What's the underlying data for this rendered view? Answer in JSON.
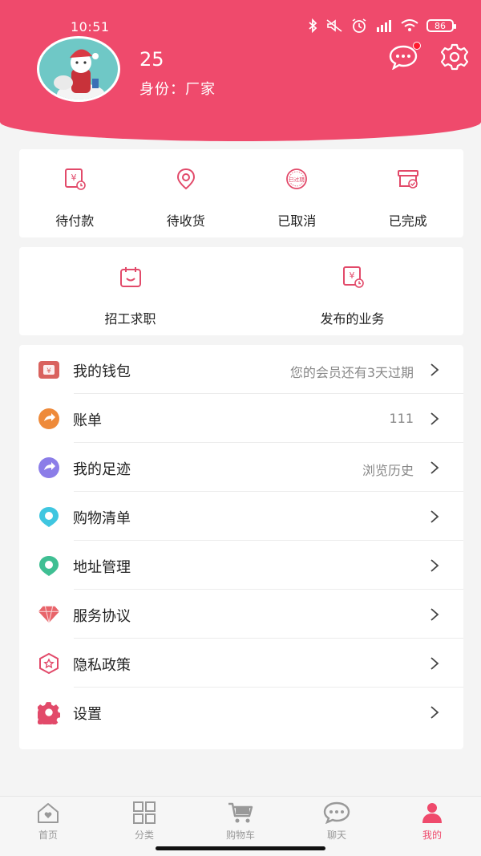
{
  "status_bar": {
    "time": "10:51",
    "battery": "86"
  },
  "profile": {
    "name": "25",
    "role": "身份：厂家"
  },
  "colors": {
    "accent": "#ef4a6c",
    "notification_dot": "#ff1a2e"
  },
  "orders": [
    {
      "label": "待付款",
      "icon": "payment-icon"
    },
    {
      "label": "待收货",
      "icon": "location-pin-icon"
    },
    {
      "label": "已取消",
      "icon": "cancelled-stamp-icon",
      "icon_text": "已过期"
    },
    {
      "label": "已完成",
      "icon": "completed-box-icon"
    }
  ],
  "business": [
    {
      "label": "招工求职",
      "icon": "calendar-smile-icon"
    },
    {
      "label": "发布的业务",
      "icon": "yuan-document-icon"
    }
  ],
  "menu": [
    {
      "label": "我的钱包",
      "value": "您的会员还有3天过期",
      "icon": "wallet-icon"
    },
    {
      "label": "账单",
      "value": "111",
      "icon": "bill-arrow-icon"
    },
    {
      "label": "我的足迹",
      "value": "浏览历史",
      "icon": "footprint-arrow-icon"
    },
    {
      "label": "购物清单",
      "value": "",
      "icon": "shopping-list-icon"
    },
    {
      "label": "地址管理",
      "value": "",
      "icon": "address-pin-icon"
    },
    {
      "label": "服务协议",
      "value": "",
      "icon": "diamond-icon"
    },
    {
      "label": "隐私政策",
      "value": "",
      "icon": "privacy-shield-icon"
    },
    {
      "label": "设置",
      "value": "",
      "icon": "gear-icon"
    }
  ],
  "tabs": [
    {
      "label": "首页",
      "icon": "home-icon",
      "active": false
    },
    {
      "label": "分类",
      "icon": "grid-icon",
      "active": false
    },
    {
      "label": "购物车",
      "icon": "cart-icon",
      "active": false
    },
    {
      "label": "聊天",
      "icon": "chat-icon",
      "active": false
    },
    {
      "label": "我的",
      "icon": "profile-icon",
      "active": true
    }
  ]
}
